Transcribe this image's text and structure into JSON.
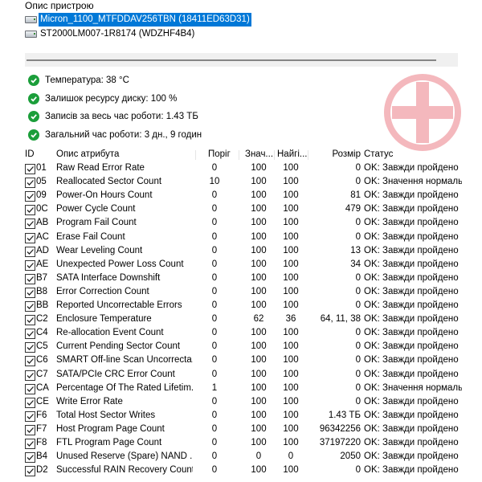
{
  "devices_label": "Опис пристрою",
  "devices": [
    {
      "label": "Micron_1100_MTFDDAV256TBN (18411ED63D31)",
      "selected": true
    },
    {
      "label": "ST2000LM007-1R8174 (WDZHF4B4)",
      "selected": false
    }
  ],
  "status": [
    {
      "text": "Температура: 38 °C"
    },
    {
      "text": "Залишок ресурсу диску: 100 %"
    },
    {
      "text": "Записів за весь час роботи: 1.43 ТБ"
    },
    {
      "text": "Загальний час роботи: 3 дн., 9 годин"
    }
  ],
  "health_icon": "health-cross-icon",
  "colors": {
    "ok": "#1b9e3a",
    "health": "#f4b8bd",
    "selection": "#0078d7"
  },
  "table": {
    "headers": {
      "id": "ID",
      "desc": "Опис атрибута",
      "thr": "Поріг",
      "val": "Знач...",
      "wor": "Найгі...",
      "raw": "Розмір",
      "st": "Статус"
    },
    "rows": [
      {
        "id": "01",
        "desc": "Raw Read Error Rate",
        "thr": "0",
        "val": "100",
        "wor": "100",
        "raw": "0",
        "st": "OK: Завжди пройдено"
      },
      {
        "id": "05",
        "desc": "Reallocated Sector Count",
        "thr": "10",
        "val": "100",
        "wor": "100",
        "raw": "0",
        "st": "OK: Значення нормальне"
      },
      {
        "id": "09",
        "desc": "Power-On Hours Count",
        "thr": "0",
        "val": "100",
        "wor": "100",
        "raw": "81",
        "st": "OK: Завжди пройдено"
      },
      {
        "id": "0C",
        "desc": "Power Cycle Count",
        "thr": "0",
        "val": "100",
        "wor": "100",
        "raw": "479",
        "st": "OK: Завжди пройдено"
      },
      {
        "id": "AB",
        "desc": "Program Fail Count",
        "thr": "0",
        "val": "100",
        "wor": "100",
        "raw": "0",
        "st": "OK: Завжди пройдено"
      },
      {
        "id": "AC",
        "desc": "Erase Fail Count",
        "thr": "0",
        "val": "100",
        "wor": "100",
        "raw": "0",
        "st": "OK: Завжди пройдено"
      },
      {
        "id": "AD",
        "desc": "Wear Leveling Count",
        "thr": "0",
        "val": "100",
        "wor": "100",
        "raw": "13",
        "st": "OK: Завжди пройдено"
      },
      {
        "id": "AE",
        "desc": "Unexpected Power Loss Count",
        "thr": "0",
        "val": "100",
        "wor": "100",
        "raw": "34",
        "st": "OK: Завжди пройдено"
      },
      {
        "id": "B7",
        "desc": "SATA Interface Downshift",
        "thr": "0",
        "val": "100",
        "wor": "100",
        "raw": "0",
        "st": "OK: Завжди пройдено"
      },
      {
        "id": "B8",
        "desc": "Error Correction Count",
        "thr": "0",
        "val": "100",
        "wor": "100",
        "raw": "0",
        "st": "OK: Завжди пройдено"
      },
      {
        "id": "BB",
        "desc": "Reported Uncorrectable Errors",
        "thr": "0",
        "val": "100",
        "wor": "100",
        "raw": "0",
        "st": "OK: Завжди пройдено"
      },
      {
        "id": "C2",
        "desc": "Enclosure Temperature",
        "thr": "0",
        "val": "62",
        "wor": "36",
        "raw": "64, 11, 38",
        "st": "OK: Завжди пройдено"
      },
      {
        "id": "C4",
        "desc": "Re-allocation Event Count",
        "thr": "0",
        "val": "100",
        "wor": "100",
        "raw": "0",
        "st": "OK: Завжди пройдено"
      },
      {
        "id": "C5",
        "desc": "Current Pending Sector Count",
        "thr": "0",
        "val": "100",
        "wor": "100",
        "raw": "0",
        "st": "OK: Завжди пройдено"
      },
      {
        "id": "C6",
        "desc": "SMART Off-line Scan Uncorrecta...",
        "thr": "0",
        "val": "100",
        "wor": "100",
        "raw": "0",
        "st": "OK: Завжди пройдено"
      },
      {
        "id": "C7",
        "desc": "SATA/PCIe CRC Error Count",
        "thr": "0",
        "val": "100",
        "wor": "100",
        "raw": "0",
        "st": "OK: Завжди пройдено"
      },
      {
        "id": "CA",
        "desc": "Percentage Of The Rated Lifetim...",
        "thr": "1",
        "val": "100",
        "wor": "100",
        "raw": "0",
        "st": "OK: Значення нормальне"
      },
      {
        "id": "CE",
        "desc": "Write Error Rate",
        "thr": "0",
        "val": "100",
        "wor": "100",
        "raw": "0",
        "st": "OK: Завжди пройдено"
      },
      {
        "id": "F6",
        "desc": "Total Host Sector Writes",
        "thr": "0",
        "val": "100",
        "wor": "100",
        "raw": "1.43 ТБ",
        "st": "OK: Завжди пройдено"
      },
      {
        "id": "F7",
        "desc": "Host Program Page Count",
        "thr": "0",
        "val": "100",
        "wor": "100",
        "raw": "96342256",
        "st": "OK: Завжди пройдено"
      },
      {
        "id": "F8",
        "desc": "FTL Program Page Count",
        "thr": "0",
        "val": "100",
        "wor": "100",
        "raw": "37197220",
        "st": "OK: Завжди пройдено"
      },
      {
        "id": "B4",
        "desc": "Unused Reserve (Spare) NAND ...",
        "thr": "0",
        "val": "0",
        "wor": "0",
        "raw": "2050",
        "st": "OK: Завжди пройдено"
      },
      {
        "id": "D2",
        "desc": "Successful RAIN Recovery Count",
        "thr": "0",
        "val": "100",
        "wor": "100",
        "raw": "0",
        "st": "OK: Завжди пройдено"
      }
    ]
  }
}
